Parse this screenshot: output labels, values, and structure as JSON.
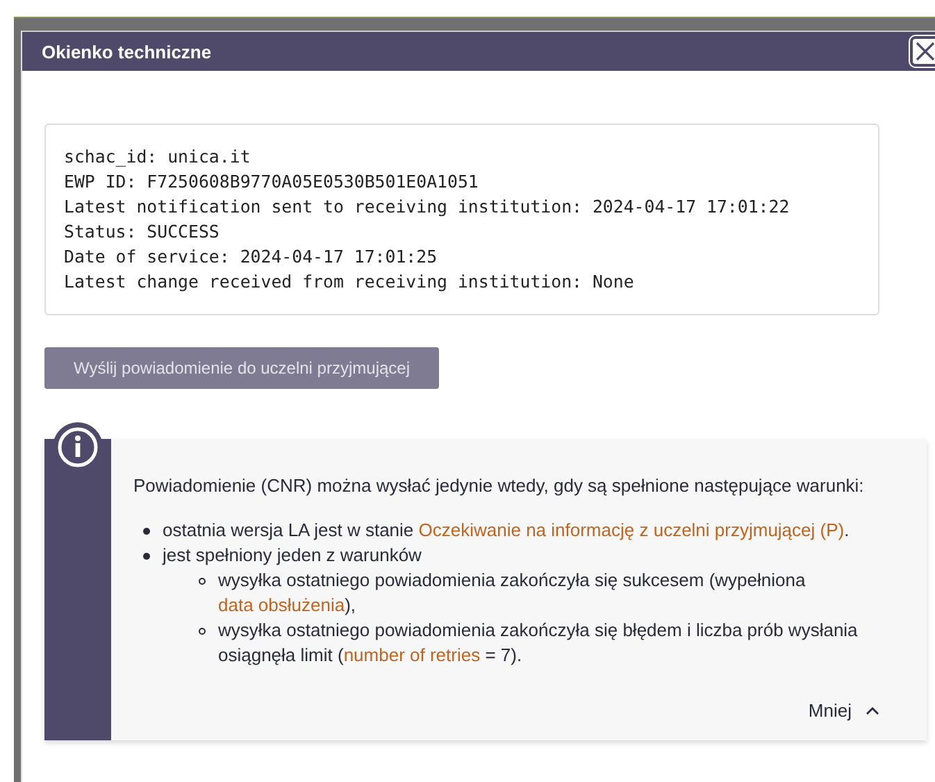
{
  "dialog": {
    "title": "Okienko techniczne"
  },
  "details": [
    "schac_id: unica.it",
    "EWP ID: F7250608B9770A05E0530B501E0A1051",
    "Latest notification sent to receiving institution: 2024-04-17 17:01:22",
    "Status: SUCCESS",
    "Date of service: 2024-04-17 17:01:25",
    "Latest change received from receiving institution: None"
  ],
  "send_button": {
    "label": "Wyślij powiadomienie do uczelni przyjmującej",
    "disabled": true
  },
  "info": {
    "intro": "Powiadomienie (CNR) można wysłać jedynie wtedy, gdy są spełnione następujące warunki:",
    "conditions": [
      {
        "parts": [
          {
            "text": "ostatnia wersja LA jest w stanie ",
            "highlight": false
          },
          {
            "text": "Oczekiwanie na informację z uczelni przyjmującej (P)",
            "highlight": true
          },
          {
            "text": ".",
            "highlight": false
          }
        ]
      },
      {
        "parts": [
          {
            "text": "jest spełniony jeden z warunków",
            "highlight": false
          }
        ],
        "children": [
          {
            "parts": [
              {
                "text": "wysyłka ostatniego powiadomienia zakończyła się sukcesem (wypełniona ",
                "highlight": false
              },
              {
                "text": "data obsłużenia",
                "highlight": true
              },
              {
                "text": "),",
                "highlight": false
              }
            ]
          },
          {
            "parts": [
              {
                "text": "wysyłka ostatniego powiadomienia zakończyła się błędem i liczba prób wysłania osiągnęła limit (",
                "highlight": false
              },
              {
                "text": "number of retries",
                "highlight": true
              },
              {
                "text": " = 7).",
                "highlight": false
              }
            ]
          }
        ]
      }
    ],
    "toggle": {
      "label": "Mniej",
      "expanded": true
    }
  }
}
